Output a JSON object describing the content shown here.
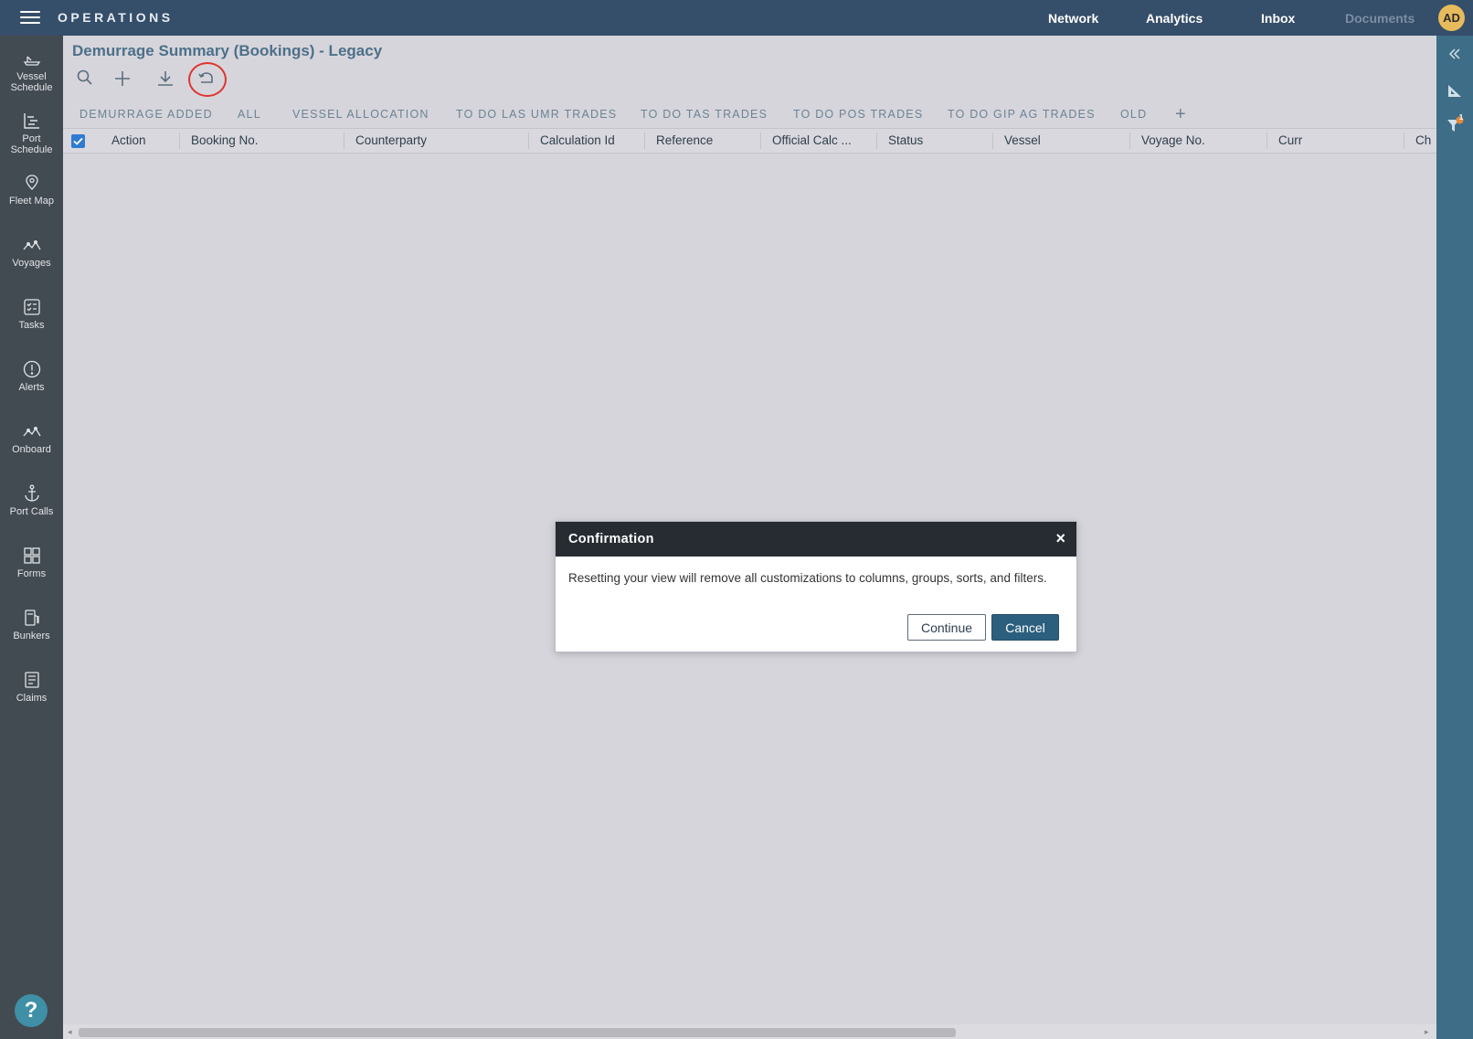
{
  "header": {
    "app_title": "OPERATIONS",
    "nav": [
      {
        "label": "Network",
        "state": "active"
      },
      {
        "label": "Analytics",
        "state": "active"
      },
      {
        "label": "Inbox",
        "state": "active"
      },
      {
        "label": "Documents",
        "state": "disabled"
      }
    ],
    "avatar_initials": "AD"
  },
  "sidebar": {
    "items": [
      {
        "label": "Vessel Schedule",
        "icon": "ship-icon"
      },
      {
        "label": "Port Schedule",
        "icon": "gantt-icon"
      },
      {
        "label": "Fleet Map",
        "icon": "map-pin-icon"
      },
      {
        "label": "Voyages",
        "icon": "route-icon"
      },
      {
        "label": "Tasks",
        "icon": "checklist-icon"
      },
      {
        "label": "Alerts",
        "icon": "alert-icon"
      },
      {
        "label": "Onboard",
        "icon": "route-icon"
      },
      {
        "label": "Port Calls",
        "icon": "anchor-icon"
      },
      {
        "label": "Forms",
        "icon": "forms-icon"
      },
      {
        "label": "Bunkers",
        "icon": "fuel-icon"
      },
      {
        "label": "Claims",
        "icon": "claims-icon"
      }
    ],
    "help_label": "?"
  },
  "rightrail": {
    "filter_badge": "1"
  },
  "page": {
    "title": "Demurrage Summary (Bookings) - Legacy"
  },
  "toolbar": {
    "icons": [
      "search-icon",
      "add-icon",
      "download-icon",
      "reset-view-icon"
    ]
  },
  "tabs": [
    "DEMURRAGE ADDED",
    "ALL",
    "VESSEL ALLOCATION",
    "TO DO LAS UMR TRADES",
    "TO DO TAS TRADES",
    "TO DO POS TRADES",
    "TO DO GIP AG TRADES",
    "OLD"
  ],
  "tab_add_label": "+",
  "grid": {
    "columns": [
      "Action",
      "Booking No.",
      "Counterparty",
      "Calculation Id",
      "Reference",
      "Official Calc ...",
      "Status",
      "Vessel",
      "Voyage No.",
      "Curr",
      "Ch"
    ]
  },
  "dialog": {
    "title": "Confirmation",
    "close_label": "×",
    "message": "Resetting your view will remove all customizations to columns, groups, sorts, and filters.",
    "continue_label": "Continue",
    "cancel_label": "Cancel"
  },
  "colors": {
    "topbar": "#354e6a",
    "sidebar": "#434b52",
    "rightrail": "#3e6d88",
    "accent": "#2c5f7e",
    "highlight_ring": "#e0332f"
  }
}
